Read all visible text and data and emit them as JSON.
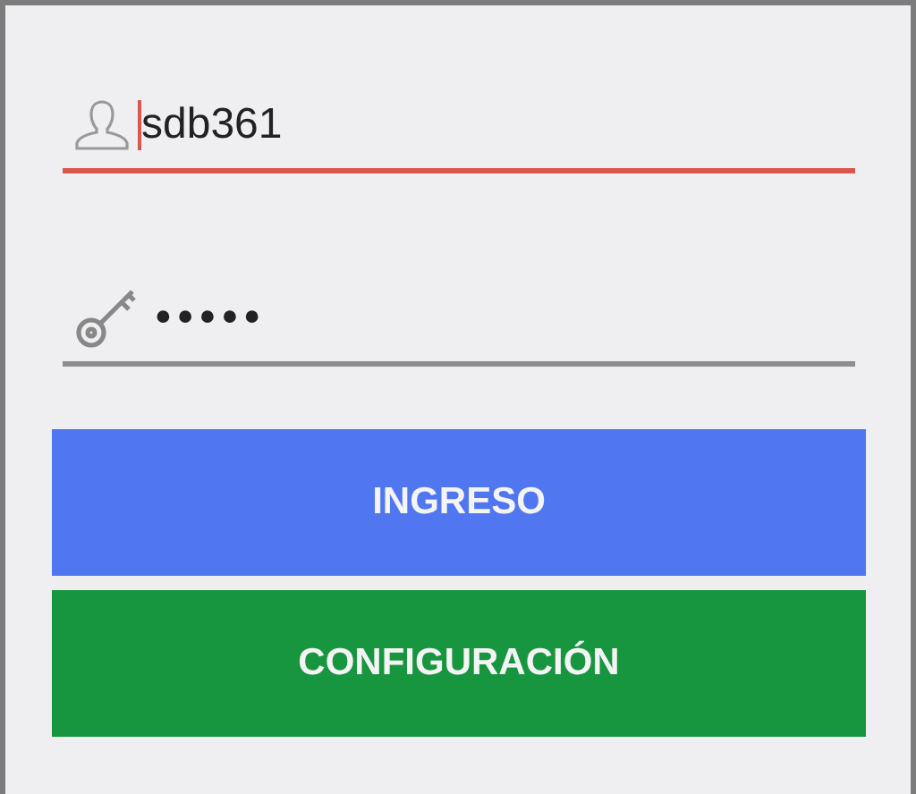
{
  "fields": [
    {
      "kind": "user",
      "value": "sdb361",
      "focused": true
    },
    {
      "kind": "password",
      "value": "•••••",
      "focused": false
    }
  ],
  "buttons": [
    {
      "label": "INGRESO",
      "color": "#5077f0"
    },
    {
      "label": "CONFIGURACIÓN",
      "color": "#17963f"
    }
  ]
}
